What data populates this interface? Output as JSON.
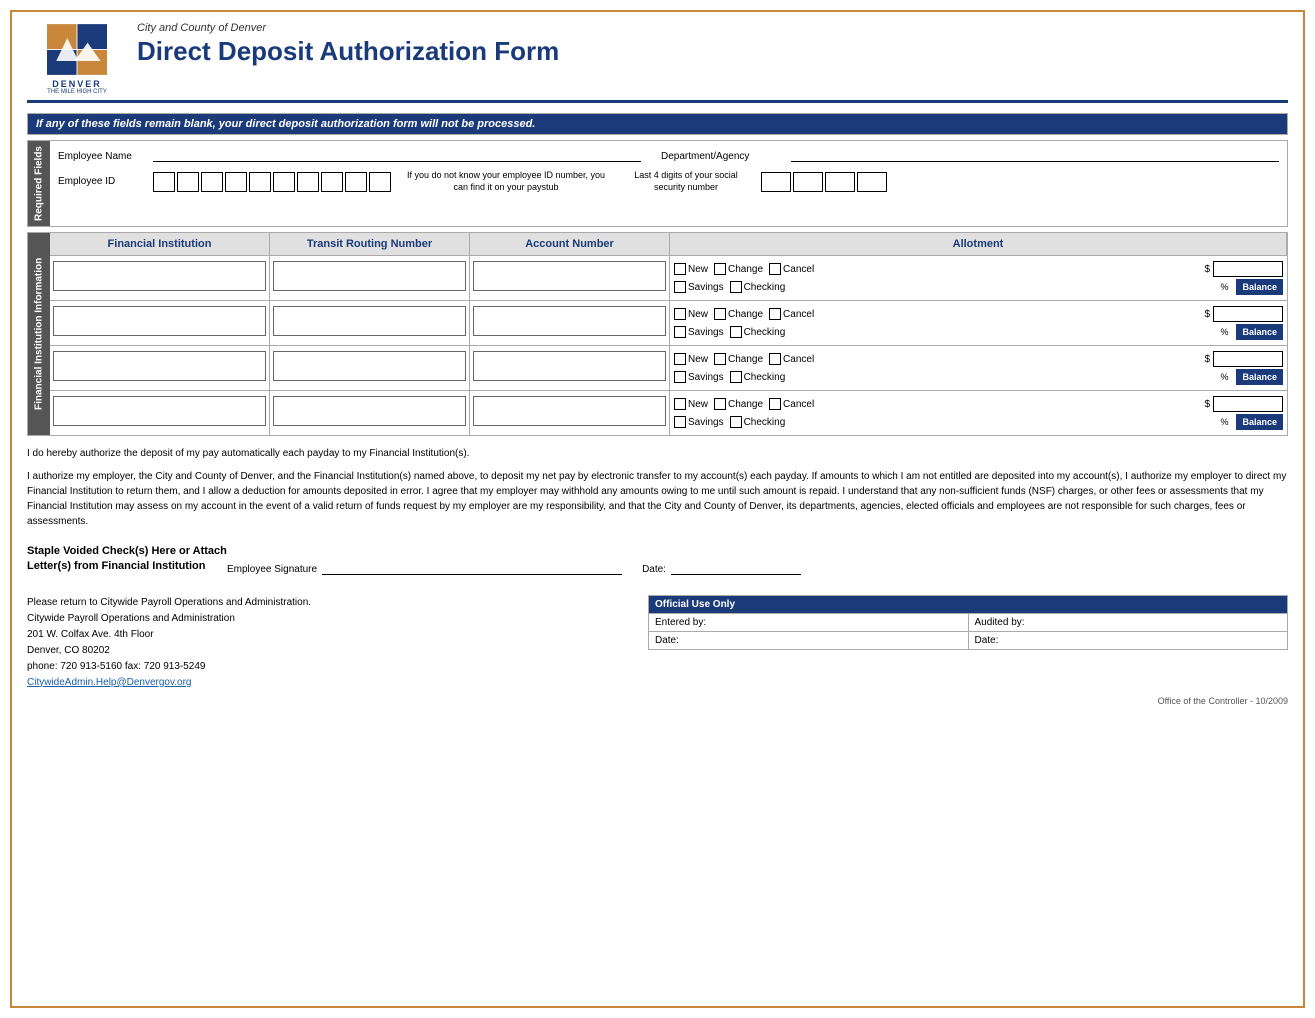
{
  "header": {
    "subtitle": "City and County of Denver",
    "title": "Direct Deposit Authorization Form",
    "logo_text": "DENVER",
    "logo_subtext": "THE MILE HIGH CITY"
  },
  "warning": {
    "text": "If any of these fields remain blank, your direct deposit authorization form will not be processed."
  },
  "required_fields": {
    "side_label": "Required Fields",
    "employee_name_label": "Employee Name",
    "dept_agency_label": "Department/Agency",
    "employee_id_label": "Employee ID",
    "emp_id_note": "If you do not know your employee ID number, you can find it on your paystub",
    "last4_label": "Last 4 digits of your social security number"
  },
  "fi_table": {
    "side_label": "Financial Institution Information",
    "headers": [
      "Financial Institution",
      "Transit Routing Number",
      "Account Number",
      "Allotment"
    ],
    "rows": [
      {
        "allotment": {
          "new": "New",
          "change": "Change",
          "cancel": "Cancel",
          "dollar": "$",
          "percent": "%",
          "savings": "Savings",
          "checking": "Checking",
          "balance": "Balance"
        }
      },
      {
        "allotment": {
          "new": "New",
          "change": "Change",
          "cancel": "Cancel",
          "dollar": "$",
          "percent": "%",
          "savings": "Savings",
          "checking": "Checking",
          "balance": "Balance"
        }
      },
      {
        "allotment": {
          "new": "New",
          "change": "Change",
          "cancel": "Cancel",
          "dollar": "$",
          "percent": "%",
          "savings": "Savings",
          "checking": "Checking",
          "balance": "Balance"
        }
      },
      {
        "allotment": {
          "new": "New",
          "change": "Change",
          "cancel": "Cancel",
          "dollar": "$",
          "percent": "%",
          "savings": "Savings",
          "checking": "Checking",
          "balance": "Balance"
        }
      }
    ]
  },
  "auth_short": "I do hereby authorize the deposit of my pay automatically each payday to my Financial Institution(s).",
  "auth_long": "I authorize my employer, the City and County of Denver, and the Financial Institution(s) named above, to deposit my net pay by electronic transfer to my account(s) each payday. If amounts to which I am not entitled are deposited into my account(s), I authorize my employer to direct my Financial Institution to return them, and I allow a deduction for amounts deposited in error. I agree that my employer may withhold any amounts owing to me until such amount is repaid. I understand that any non-sufficient funds (NSF) charges, or other fees or assessments that my Financial Institution may assess on my account in the event of a valid return of funds request by my employer are my responsibility, and that the City and County of Denver, its departments, agencies, elected officials and employees are not responsible for such charges, fees or assessments.",
  "staple": {
    "line1": "Staple Voided Check(s) Here or Attach",
    "line2": "Letter(s) from Financial Institution"
  },
  "signature": {
    "sig_label": "Employee Signature",
    "date_label": "Date:"
  },
  "contact": {
    "line1": "Please return to Citywide Payroll Operations and Administration.",
    "line2": "Citywide Payroll Operations and Administration",
    "line3": "201 W. Colfax Ave. 4th Floor",
    "line4": "Denver, CO 80202",
    "line5": "phone: 720 913-5160    fax: 720 913-5249",
    "link": "CitywideAdmin.Help@Denvergov.org"
  },
  "official_use": {
    "title": "Official Use Only",
    "entered_by": "Entered by:",
    "audited_by": "Audited by:",
    "date_left": "Date:",
    "date_right": "Date:"
  },
  "footer": "Office of the Controller - 10/2009"
}
